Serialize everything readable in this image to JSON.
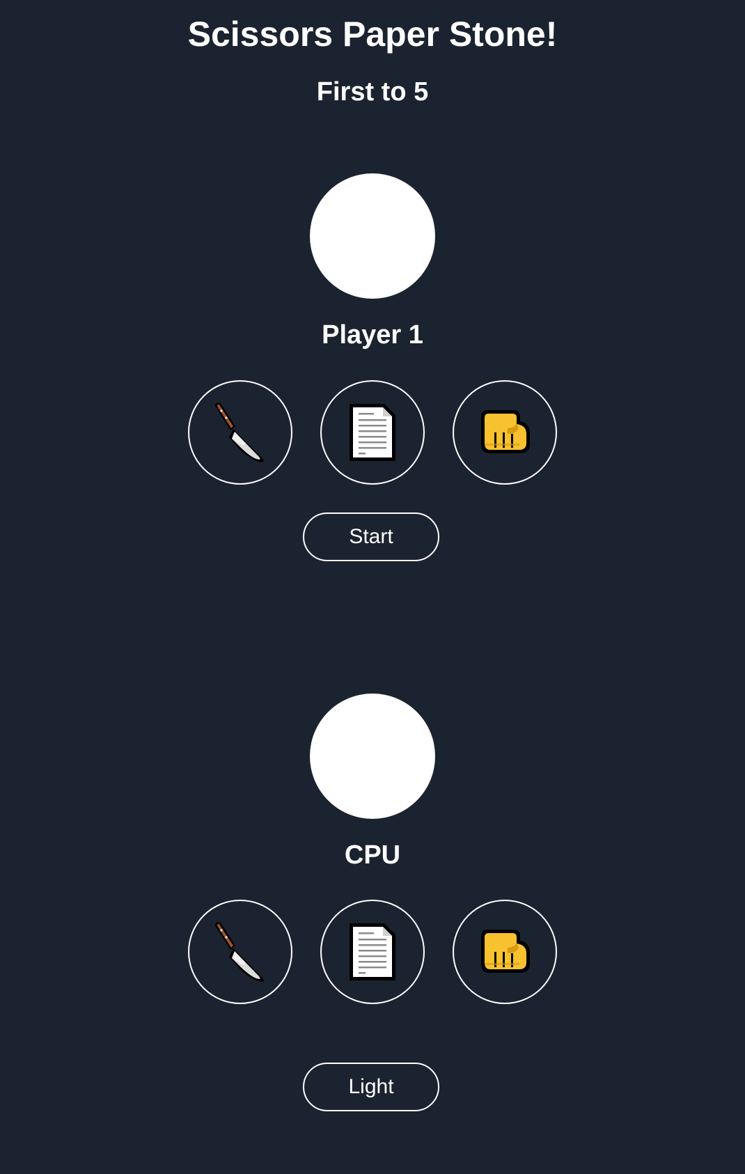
{
  "header": {
    "title": "Scissors Paper Stone!",
    "subtitle": "First to 5"
  },
  "player": {
    "name": "Player 1",
    "choices": [
      {
        "icon": "knife-icon"
      },
      {
        "icon": "page-icon"
      },
      {
        "icon": "fist-icon"
      }
    ],
    "start_label": "Start"
  },
  "cpu": {
    "name": "CPU",
    "choices": [
      {
        "icon": "knife-icon"
      },
      {
        "icon": "page-icon"
      },
      {
        "icon": "fist-icon"
      }
    ]
  },
  "theme": {
    "toggle_label": "Light",
    "background": "#1c2330",
    "foreground": "#ffffff",
    "fist_color": "#f7c12f"
  }
}
